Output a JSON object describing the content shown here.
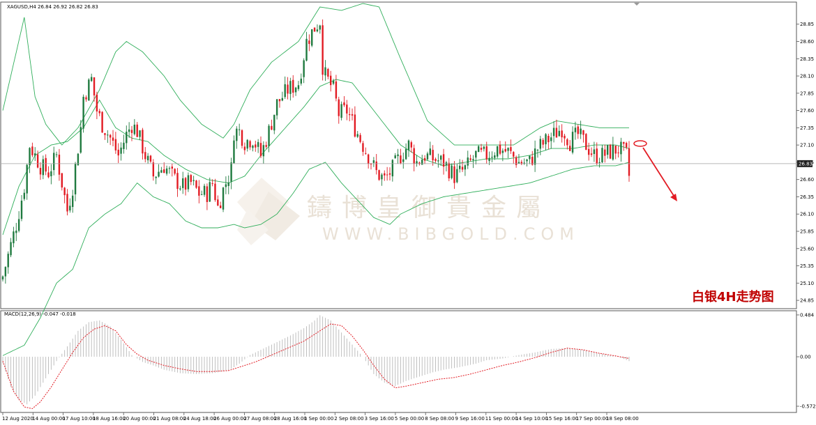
{
  "chart_data": [
    {
      "type": "candlestick",
      "symbol_header": "XAGUSD,H4  26.84 26.92 26.82 26.83",
      "title": "白银4H走势图",
      "current_price_label": "26.83",
      "y_ticks": [
        "28.85",
        "28.60",
        "28.35",
        "28.10",
        "27.85",
        "27.60",
        "27.35",
        "27.10",
        "26.85",
        "26.60",
        "26.35",
        "26.10",
        "25.85",
        "25.60",
        "25.35",
        "25.10",
        "24.85"
      ],
      "ylim": [
        24.75,
        29.15
      ],
      "x_ticks": [
        "12 Aug 2020",
        "14 Aug 00:00",
        "17 Aug 10:00",
        "18 Aug 16:00",
        "20 Aug 00:00",
        "21 Aug 08:00",
        "24 Aug 18:00",
        "26 Aug 00:00",
        "27 Aug 08:00",
        "28 Aug 16:00",
        "1 Sep 00:00",
        "2 Sep 08:00",
        "3 Sep 16:00",
        "5 Sep 00:00",
        "8 Sep 08:00",
        "9 Sep 16:00",
        "11 Sep 00:00",
        "14 Sep 10:00",
        "15 Sep 16:00",
        "17 Sep 00:00",
        "18 Sep 08:00"
      ],
      "bar_count": 150,
      "close_anchors": [
        [
          0,
          25.2
        ],
        [
          5,
          25.95
        ],
        [
          8,
          26.5
        ],
        [
          10,
          27.1
        ],
        [
          14,
          26.8
        ],
        [
          17,
          26.7
        ],
        [
          20,
          26.95
        ],
        [
          24,
          26.15
        ],
        [
          26,
          26.5
        ],
        [
          29,
          27.35
        ],
        [
          30,
          27.8
        ],
        [
          33,
          28.05
        ],
        [
          35,
          27.6
        ],
        [
          37,
          27.4
        ],
        [
          40,
          27.2
        ],
        [
          43,
          26.95
        ],
        [
          46,
          27.25
        ],
        [
          48,
          27.4
        ],
        [
          50,
          27.3
        ],
        [
          53,
          26.95
        ],
        [
          56,
          26.65
        ],
        [
          60,
          26.8
        ],
        [
          64,
          26.6
        ],
        [
          67,
          26.5
        ],
        [
          70,
          26.55
        ],
        [
          73,
          26.4
        ],
        [
          76,
          26.4
        ],
        [
          78,
          26.55
        ],
        [
          80,
          26.2
        ],
        [
          82,
          26.45
        ],
        [
          85,
          26.75
        ],
        [
          86,
          27.3
        ],
        [
          88,
          27.3
        ],
        [
          90,
          27.15
        ],
        [
          93,
          27.2
        ],
        [
          96,
          26.95
        ],
        [
          99,
          27.3
        ],
        [
          102,
          27.7
        ],
        [
          106,
          27.9
        ],
        [
          110,
          28.0
        ],
        [
          113,
          28.6
        ],
        [
          116,
          28.8
        ],
        [
          118,
          28.9
        ],
        [
          119,
          28.25
        ],
        [
          120,
          28.1
        ],
        [
          123,
          27.9
        ],
        [
          125,
          27.55
        ],
        [
          128,
          27.6
        ],
        [
          131,
          27.35
        ],
        [
          134,
          27.1
        ],
        [
          136,
          26.95
        ],
        [
          139,
          26.7
        ],
        [
          142,
          26.6
        ],
        [
          145,
          26.75
        ],
        [
          148,
          26.95
        ],
        [
          151,
          27.1
        ],
        [
          154,
          26.85
        ],
        [
          157,
          26.95
        ],
        [
          160,
          26.9
        ],
        [
          164,
          26.85
        ],
        [
          168,
          26.65
        ],
        [
          172,
          26.75
        ],
        [
          176,
          26.95
        ],
        [
          180,
          26.95
        ],
        [
          184,
          27.05
        ],
        [
          188,
          27.0
        ],
        [
          192,
          26.85
        ],
        [
          196,
          26.85
        ],
        [
          199,
          27.05
        ],
        [
          202,
          27.15
        ],
        [
          205,
          27.25
        ],
        [
          208,
          27.35
        ],
        [
          211,
          27.15
        ],
        [
          214,
          27.25
        ],
        [
          217,
          27.1
        ],
        [
          220,
          26.95
        ],
        [
          223,
          26.95
        ],
        [
          226,
          27.0
        ],
        [
          229,
          27.05
        ],
        [
          232,
          26.95
        ],
        [
          233,
          26.65
        ]
      ],
      "series": [
        {
          "name": "",
          "kind": "bollinger_upper",
          "values": [
            [
              0,
              27.6
            ],
            [
              8,
              28.95
            ],
            [
              12,
              27.8
            ],
            [
              16,
              27.4
            ],
            [
              22,
              27.1
            ],
            [
              28,
              27.35
            ],
            [
              36,
              27.9
            ],
            [
              42,
              28.45
            ],
            [
              46,
              28.6
            ],
            [
              52,
              28.45
            ],
            [
              60,
              28.1
            ],
            [
              66,
              27.75
            ],
            [
              74,
              27.4
            ],
            [
              82,
              27.2
            ],
            [
              86,
              27.4
            ],
            [
              92,
              27.9
            ],
            [
              100,
              28.3
            ],
            [
              110,
              28.6
            ],
            [
              118,
              29.1
            ],
            [
              126,
              29.05
            ],
            [
              134,
              29.15
            ],
            [
              140,
              29.1
            ],
            [
              148,
              28.35
            ],
            [
              158,
              27.45
            ],
            [
              168,
              27.1
            ],
            [
              180,
              27.1
            ],
            [
              190,
              27.1
            ],
            [
              200,
              27.35
            ],
            [
              206,
              27.45
            ],
            [
              214,
              27.4
            ],
            [
              222,
              27.35
            ],
            [
              230,
              27.35
            ],
            [
              233,
              27.35
            ]
          ]
        },
        {
          "name": "",
          "kind": "bollinger_middle",
          "values": [
            [
              0,
              25.8
            ],
            [
              6,
              26.5
            ],
            [
              12,
              26.95
            ],
            [
              18,
              27.1
            ],
            [
              24,
              27.15
            ],
            [
              30,
              27.35
            ],
            [
              36,
              27.75
            ],
            [
              42,
              27.35
            ],
            [
              48,
              27.2
            ],
            [
              54,
              27.15
            ],
            [
              60,
              26.95
            ],
            [
              68,
              26.75
            ],
            [
              76,
              26.6
            ],
            [
              84,
              26.55
            ],
            [
              90,
              26.65
            ],
            [
              96,
              26.95
            ],
            [
              104,
              27.3
            ],
            [
              112,
              27.65
            ],
            [
              118,
              27.95
            ],
            [
              124,
              28.05
            ],
            [
              130,
              28.0
            ],
            [
              136,
              27.7
            ],
            [
              142,
              27.4
            ],
            [
              148,
              27.1
            ],
            [
              156,
              26.9
            ],
            [
              164,
              26.8
            ],
            [
              172,
              26.85
            ],
            [
              180,
              26.9
            ],
            [
              188,
              26.9
            ],
            [
              196,
              26.95
            ],
            [
              204,
              27.05
            ],
            [
              212,
              27.05
            ],
            [
              220,
              27.1
            ],
            [
              228,
              27.1
            ],
            [
              233,
              27.05
            ]
          ]
        },
        {
          "name": "",
          "kind": "bollinger_lower",
          "values": [
            [
              0,
              24.05
            ],
            [
              8,
              24.2
            ],
            [
              14,
              24.6
            ],
            [
              20,
              25.1
            ],
            [
              26,
              25.3
            ],
            [
              32,
              25.9
            ],
            [
              38,
              26.1
            ],
            [
              44,
              26.25
            ],
            [
              50,
              26.55
            ],
            [
              56,
              26.35
            ],
            [
              62,
              26.25
            ],
            [
              68,
              26.0
            ],
            [
              74,
              25.9
            ],
            [
              80,
              25.9
            ],
            [
              86,
              25.95
            ],
            [
              90,
              25.9
            ],
            [
              96,
              25.95
            ],
            [
              102,
              26.1
            ],
            [
              108,
              26.4
            ],
            [
              114,
              26.75
            ],
            [
              120,
              26.85
            ],
            [
              126,
              26.55
            ],
            [
              132,
              26.3
            ],
            [
              138,
              26.05
            ],
            [
              144,
              25.95
            ],
            [
              148,
              26.1
            ],
            [
              156,
              26.25
            ],
            [
              164,
              26.35
            ],
            [
              172,
              26.4
            ],
            [
              180,
              26.45
            ],
            [
              188,
              26.5
            ],
            [
              196,
              26.55
            ],
            [
              204,
              26.65
            ],
            [
              212,
              26.75
            ],
            [
              220,
              26.8
            ],
            [
              228,
              26.8
            ],
            [
              233,
              26.85
            ]
          ]
        }
      ]
    },
    {
      "type": "bar",
      "header": "MACD(12,26,9) -0.047 -0.018",
      "y_ticks": [
        "0.484",
        "0.00",
        "-0.572"
      ],
      "ylim": [
        -0.62,
        0.5
      ],
      "histogram_anchors": [
        [
          0,
          -0.08
        ],
        [
          3,
          -0.35
        ],
        [
          6,
          -0.5
        ],
        [
          9,
          -0.55
        ],
        [
          12,
          -0.45
        ],
        [
          16,
          -0.25
        ],
        [
          20,
          -0.05
        ],
        [
          24,
          0.12
        ],
        [
          28,
          0.3
        ],
        [
          32,
          0.4
        ],
        [
          36,
          0.42
        ],
        [
          40,
          0.35
        ],
        [
          44,
          0.2
        ],
        [
          48,
          0.02
        ],
        [
          52,
          -0.06
        ],
        [
          56,
          -0.1
        ],
        [
          60,
          -0.15
        ],
        [
          66,
          -0.19
        ],
        [
          72,
          -0.2
        ],
        [
          78,
          -0.19
        ],
        [
          84,
          -0.16
        ],
        [
          88,
          -0.08
        ],
        [
          92,
          0.02
        ],
        [
          96,
          0.08
        ],
        [
          100,
          0.14
        ],
        [
          106,
          0.23
        ],
        [
          112,
          0.33
        ],
        [
          116,
          0.42
        ],
        [
          118,
          0.48
        ],
        [
          122,
          0.42
        ],
        [
          126,
          0.28
        ],
        [
          130,
          0.14
        ],
        [
          134,
          0.0
        ],
        [
          138,
          -0.2
        ],
        [
          142,
          -0.3
        ],
        [
          146,
          -0.34
        ],
        [
          150,
          -0.28
        ],
        [
          156,
          -0.22
        ],
        [
          160,
          -0.18
        ],
        [
          164,
          -0.15
        ],
        [
          170,
          -0.12
        ],
        [
          176,
          -0.08
        ],
        [
          180,
          -0.04
        ],
        [
          186,
          -0.02
        ],
        [
          192,
          0.02
        ],
        [
          198,
          0.05
        ],
        [
          204,
          0.09
        ],
        [
          210,
          0.1
        ],
        [
          216,
          0.08
        ],
        [
          222,
          0.04
        ],
        [
          228,
          0.01
        ],
        [
          233,
          -0.05
        ]
      ],
      "signal_anchors": [
        [
          0,
          -0.05
        ],
        [
          4,
          -0.4
        ],
        [
          8,
          -0.58
        ],
        [
          11,
          -0.6
        ],
        [
          14,
          -0.52
        ],
        [
          18,
          -0.35
        ],
        [
          22,
          -0.15
        ],
        [
          26,
          0.05
        ],
        [
          30,
          0.22
        ],
        [
          34,
          0.32
        ],
        [
          38,
          0.36
        ],
        [
          42,
          0.3
        ],
        [
          46,
          0.14
        ],
        [
          50,
          0.03
        ],
        [
          54,
          -0.04
        ],
        [
          60,
          -0.1
        ],
        [
          66,
          -0.14
        ],
        [
          72,
          -0.17
        ],
        [
          78,
          -0.17
        ],
        [
          84,
          -0.16
        ],
        [
          88,
          -0.12
        ],
        [
          94,
          -0.06
        ],
        [
          100,
          0.02
        ],
        [
          106,
          0.1
        ],
        [
          112,
          0.18
        ],
        [
          118,
          0.3
        ],
        [
          122,
          0.38
        ],
        [
          126,
          0.36
        ],
        [
          130,
          0.24
        ],
        [
          134,
          0.08
        ],
        [
          138,
          -0.1
        ],
        [
          142,
          -0.26
        ],
        [
          146,
          -0.36
        ],
        [
          150,
          -0.34
        ],
        [
          156,
          -0.3
        ],
        [
          162,
          -0.26
        ],
        [
          168,
          -0.24
        ],
        [
          174,
          -0.2
        ],
        [
          180,
          -0.15
        ],
        [
          186,
          -0.1
        ],
        [
          192,
          -0.06
        ],
        [
          198,
          -0.01
        ],
        [
          204,
          0.05
        ],
        [
          210,
          0.1
        ],
        [
          216,
          0.08
        ],
        [
          222,
          0.04
        ],
        [
          228,
          0.01
        ],
        [
          233,
          -0.02
        ]
      ]
    }
  ],
  "watermark": {
    "cn": "鑄博皇御貴金屬",
    "en": "WWW.BIBGOLD.COM"
  },
  "colors": {
    "up": "#1f7a3f",
    "down": "#e21b23",
    "bands": "#2fae5a",
    "signal": "#e21b23",
    "histogram": "#b8b8b8",
    "arrow": "#e21b23",
    "price_line": "#a0a0a0"
  }
}
